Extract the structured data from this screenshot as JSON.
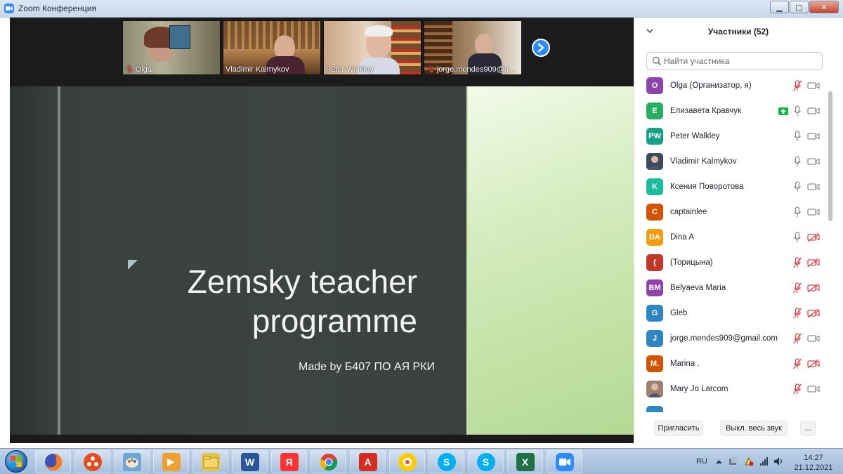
{
  "window": {
    "title": "Zoom Конференция"
  },
  "thumbnails": [
    {
      "name": "Olga",
      "muted": true
    },
    {
      "name": "Vladimir Kalmykov",
      "muted": false
    },
    {
      "name": "Peter Walkley",
      "muted": false
    },
    {
      "name": "jorge.mendes909@g...",
      "muted": true
    }
  ],
  "slide": {
    "title_line1": "Zemsky teacher",
    "title_line2": "programme",
    "subtitle": "Made by Б407 ПО АЯ РКИ"
  },
  "panel": {
    "title": "Участники (52)",
    "search_placeholder": "Найти участника",
    "participants": [
      {
        "initials": "O",
        "name": "Olga (Организатор, я)",
        "color": "#8e44ad",
        "mic": "muted",
        "cam": "on"
      },
      {
        "initials": "E",
        "name": "Елизавета Кравчук",
        "color": "#27ae60",
        "mic": "on",
        "cam": "on",
        "sharing": true
      },
      {
        "initials": "PW",
        "name": "Peter Walkley",
        "color": "#16a085",
        "mic": "on",
        "cam": "on"
      },
      {
        "initials": "",
        "name": "Vladimir Kalmykov",
        "color": "#3b4a5c",
        "mic": "on",
        "cam": "on",
        "photo": true
      },
      {
        "initials": "K",
        "name": "Ксения Поворотова",
        "color": "#1abc9c",
        "mic": "on",
        "cam": "on"
      },
      {
        "initials": "C",
        "name": "captainlee",
        "color": "#d35400",
        "mic": "on",
        "cam": "on"
      },
      {
        "initials": "DA",
        "name": "Dina A",
        "color": "#f39c12",
        "mic": "on",
        "cam": "off"
      },
      {
        "initials": "(",
        "name": " (Торицына)",
        "color": "#c0392b",
        "mic": "muted",
        "cam": "off"
      },
      {
        "initials": "BM",
        "name": "Belyaeva Maria",
        "color": "#8e44ad",
        "mic": "muted",
        "cam": "off"
      },
      {
        "initials": "G",
        "name": "Gleb",
        "color": "#2e86c1",
        "mic": "muted",
        "cam": "off"
      },
      {
        "initials": "J",
        "name": "jorge.mendes909@gmail.com",
        "color": "#2e86c1",
        "mic": "muted",
        "cam": "on"
      },
      {
        "initials": "M.",
        "name": "Marina .",
        "color": "#d35400",
        "mic": "muted",
        "cam": "off"
      },
      {
        "initials": "",
        "name": "Mary Jo Larcom",
        "color": "#a08070",
        "mic": "muted",
        "cam": "on",
        "photo": true
      }
    ],
    "invite_label": "Пригласить",
    "mute_all_label": "Выкл. весь звук",
    "more_label": "..."
  },
  "taskbar": {
    "apps": [
      {
        "name": "firefox-icon",
        "color": "#e66000",
        "glyph": ""
      },
      {
        "name": "mediaplayer-icon",
        "color": "#e74c1c",
        "glyph": ""
      },
      {
        "name": "paint-icon",
        "color": "#6aa6d8",
        "glyph": ""
      },
      {
        "name": "video-icon",
        "color": "#f0a030",
        "glyph": "▶"
      },
      {
        "name": "explorer-icon",
        "color": "#e8c34a",
        "glyph": ""
      },
      {
        "name": "word-icon",
        "color": "#2b579a",
        "glyph": "W"
      },
      {
        "name": "yandex-icon",
        "color": "#ff3333",
        "glyph": "Я"
      },
      {
        "name": "chrome-icon",
        "color": "#4caf50",
        "glyph": ""
      },
      {
        "name": "acrobat-icon",
        "color": "#d62b1f",
        "glyph": "A"
      },
      {
        "name": "yandex-browser-icon",
        "color": "#ffcc00",
        "glyph": ""
      },
      {
        "name": "skype-icon",
        "color": "#00aff0",
        "glyph": "S"
      },
      {
        "name": "skype-icon-2",
        "color": "#00aff0",
        "glyph": "S"
      },
      {
        "name": "excel-icon",
        "color": "#1e7145",
        "glyph": "X"
      },
      {
        "name": "zoom-icon",
        "color": "#2d8cff",
        "glyph": ""
      }
    ],
    "lang": "RU",
    "time": "14:27",
    "date": "21.12.2021"
  }
}
